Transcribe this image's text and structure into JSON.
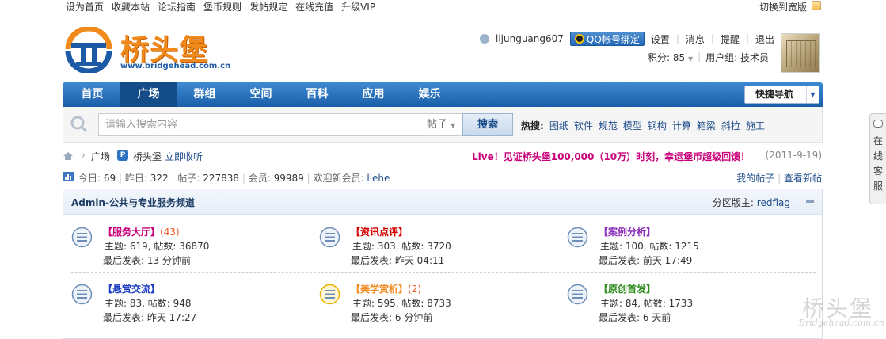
{
  "topbar": {
    "links": [
      "设为首页",
      "收藏本站",
      "论坛指南",
      "堡币规则",
      "发帖规定",
      "在线充值",
      "升级VIP"
    ],
    "wide_toggle": "切换到宽版"
  },
  "logo": {
    "text_cn": "桥头堡",
    "url": "www.bridgehead.com.cn"
  },
  "user": {
    "username": "lijunguang607",
    "qq_bind": "QQ帐号绑定",
    "links": [
      "设置",
      "消息",
      "提醒",
      "退出"
    ],
    "points_label": "积分: 85",
    "group_label": "用户组: 技术员"
  },
  "nav": {
    "items": [
      "首页",
      "广场",
      "群组",
      "空间",
      "百科",
      "应用",
      "娱乐"
    ],
    "active_index": 1,
    "quick_nav": "快捷导航"
  },
  "search": {
    "placeholder": "请输入搜索内容",
    "type": "帖子",
    "button": "搜索",
    "hot_label": "热搜:",
    "hot_terms": [
      "图纸",
      "软件",
      "规范",
      "模型",
      "钢构",
      "计算",
      "箱梁",
      "斜拉",
      "施工"
    ]
  },
  "breadcrumb": {
    "current": "广场",
    "forum_name": "桥头堡",
    "listen": "立即收听",
    "promo": "Live！见证桥头堡100,000（10万）时刻，幸运堡币超级回馈！",
    "promo_date": "(2011-9-19)"
  },
  "stats": {
    "today_label": "今日:",
    "today": "69",
    "yesterday_label": "昨日:",
    "yesterday": "322",
    "posts_label": "帖子:",
    "posts": "227838",
    "members_label": "会员:",
    "members": "99989",
    "welcome_label": "欢迎新会员:",
    "new_member": "liehe",
    "my_posts": "我的帖子",
    "new_posts": "查看新帖"
  },
  "forum_group": {
    "title": "Admin-公共与专业服务频道",
    "moderator_label": "分区版主:",
    "moderator": "redflag",
    "boards": [
      {
        "name": "【服务大厅】",
        "count": "(43)",
        "color": "#c8007a",
        "stats": "主题: 619, 帖数: 36870",
        "last": "最后发表: 13 分钟前",
        "icon_state": "normal"
      },
      {
        "name": "【资讯点评】",
        "count": "",
        "color": "#d40000",
        "stats": "主题: 303, 帖数: 3720",
        "last": "最后发表: 昨天 04:11",
        "icon_state": "normal"
      },
      {
        "name": "【案例分析】",
        "count": "",
        "color": "#8a2ab8",
        "stats": "主题: 100, 帖数: 1215",
        "last": "最后发表: 前天 17:49",
        "icon_state": "normal"
      },
      {
        "name": "【悬赏交流】",
        "count": "",
        "color": "#1a3cc2",
        "stats": "主题: 83, 帖数: 948",
        "last": "最后发表: 昨天 17:27",
        "icon_state": "normal"
      },
      {
        "name": "【美学赏析】",
        "count": "(2)",
        "color": "#f08a1c",
        "stats": "主题: 595, 帖数: 8733",
        "last": "最后发表: 6 分钟前",
        "icon_state": "new"
      },
      {
        "name": "【原创首发】",
        "count": "",
        "color": "#2a8a1a",
        "stats": "主题: 84, 帖数: 1733",
        "last": "最后发表: 6 天前",
        "icon_state": "normal"
      }
    ]
  },
  "side_chat": {
    "text": "在线客服"
  },
  "watermark": {
    "cn": "桥头堡",
    "en": "Bridgehead.com.cn"
  }
}
